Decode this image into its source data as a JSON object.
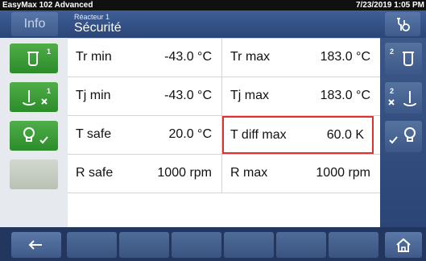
{
  "status_bar": {
    "device": "EasyMax 102 Advanced",
    "datetime": "7/23/2019 1:05 PM"
  },
  "header": {
    "info_label": "Info",
    "context_sub": "Réacteur 1",
    "context_title": "Sécurité"
  },
  "left_buttons": [
    {
      "num": "1",
      "icon": "reactor-icon"
    },
    {
      "num": "1",
      "icon": "stirrer-disabled-icon"
    },
    {
      "num": "",
      "icon": "lightbulb-check-icon"
    },
    {
      "num": "",
      "icon": ""
    }
  ],
  "right_buttons": [
    {
      "num": "2",
      "icon": "reactor-icon"
    },
    {
      "num": "2",
      "icon": "stirrer-disabled-icon"
    },
    {
      "num": "",
      "icon": "lightbulb-check-icon"
    },
    {
      "num": "",
      "icon": ""
    }
  ],
  "rows": [
    {
      "left": {
        "label": "Tr min",
        "value": "-43.0 °C"
      },
      "right": {
        "label": "Tr max",
        "value": "183.0 °C"
      }
    },
    {
      "left": {
        "label": "Tj min",
        "value": "-43.0 °C"
      },
      "right": {
        "label": "Tj max",
        "value": "183.0 °C"
      }
    },
    {
      "left": {
        "label": "T safe",
        "value": "20.0 °C"
      },
      "right": {
        "label": "T diff max",
        "value": "60.0 K"
      }
    },
    {
      "left": {
        "label": "R safe",
        "value": "1000 rpm"
      },
      "right": {
        "label": "R max",
        "value": "1000 rpm"
      }
    }
  ],
  "bottom_bar": {
    "back_icon": "back-arrow-icon",
    "home_icon": "home-icon"
  },
  "colors": {
    "header_blue": "#2b4577",
    "active_green": "#3a9a36",
    "highlight_red": "#e23030"
  }
}
